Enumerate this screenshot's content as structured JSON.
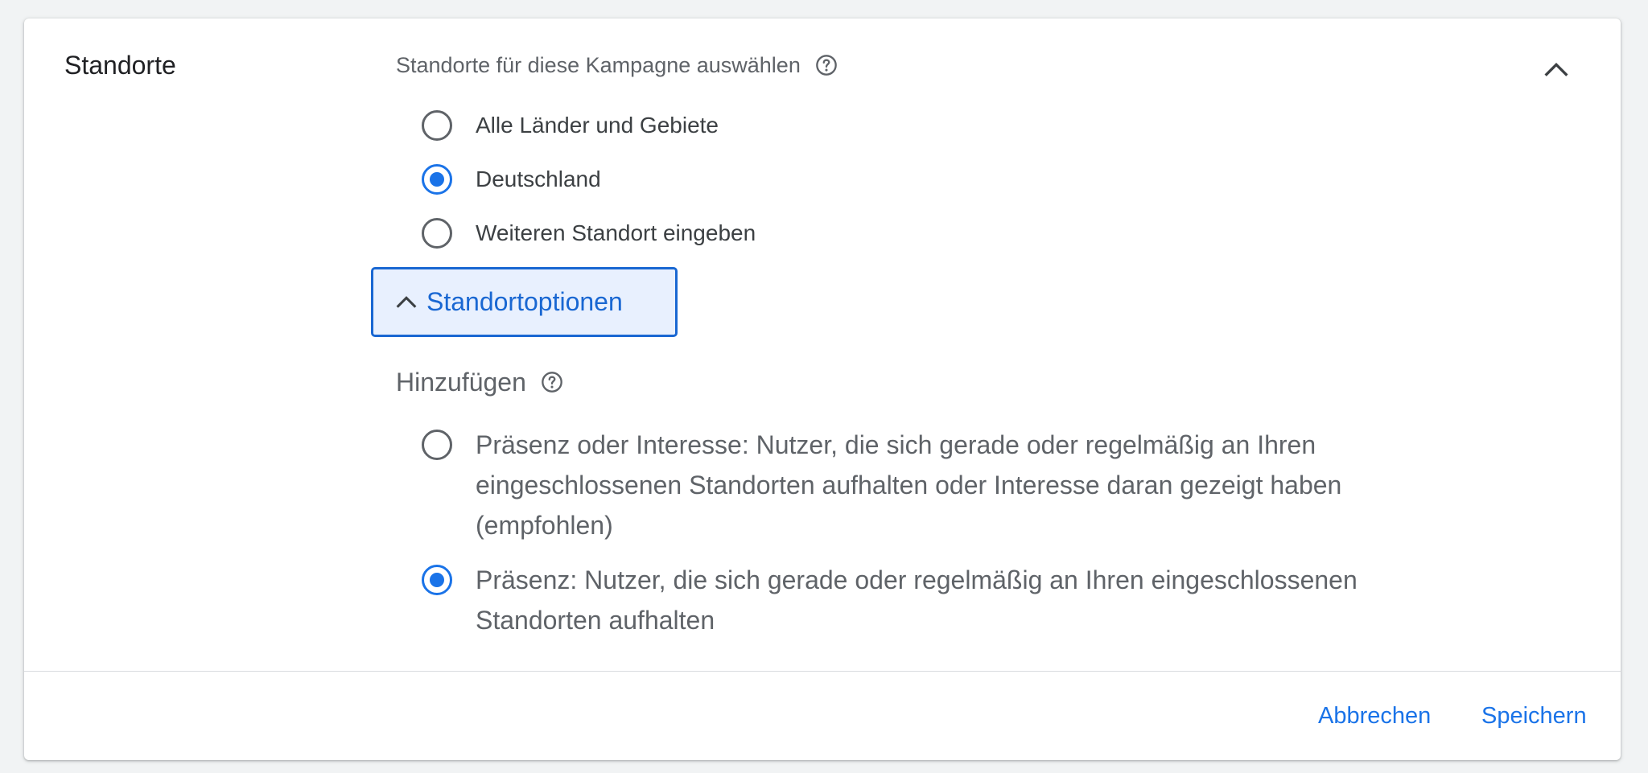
{
  "section": {
    "title": "Standorte"
  },
  "locations": {
    "prompt": "Standorte für diese Kampagne auswählen",
    "options": [
      {
        "label": "Alle Länder und Gebiete",
        "checked": false
      },
      {
        "label": "Deutschland",
        "checked": true
      },
      {
        "label": "Weiteren Standort eingeben",
        "checked": false
      }
    ]
  },
  "location_options": {
    "button_label": "Standortoptionen",
    "include_title": "Hinzufügen",
    "include_options": [
      {
        "label": "Präsenz oder Interesse: Nutzer, die sich gerade oder regelmäßig an Ihren eingeschlossenen Standorten aufhalten oder Interesse daran gezeigt haben (empfohlen)",
        "checked": false
      },
      {
        "label": "Präsenz: Nutzer, die sich gerade oder regelmäßig an Ihren eingeschlossenen Standorten aufhalten",
        "checked": true
      }
    ]
  },
  "footer": {
    "cancel_label": "Abbrechen",
    "save_label": "Speichern"
  },
  "colors": {
    "accent": "#1a73e8",
    "button_bg": "#e8f0fe"
  }
}
